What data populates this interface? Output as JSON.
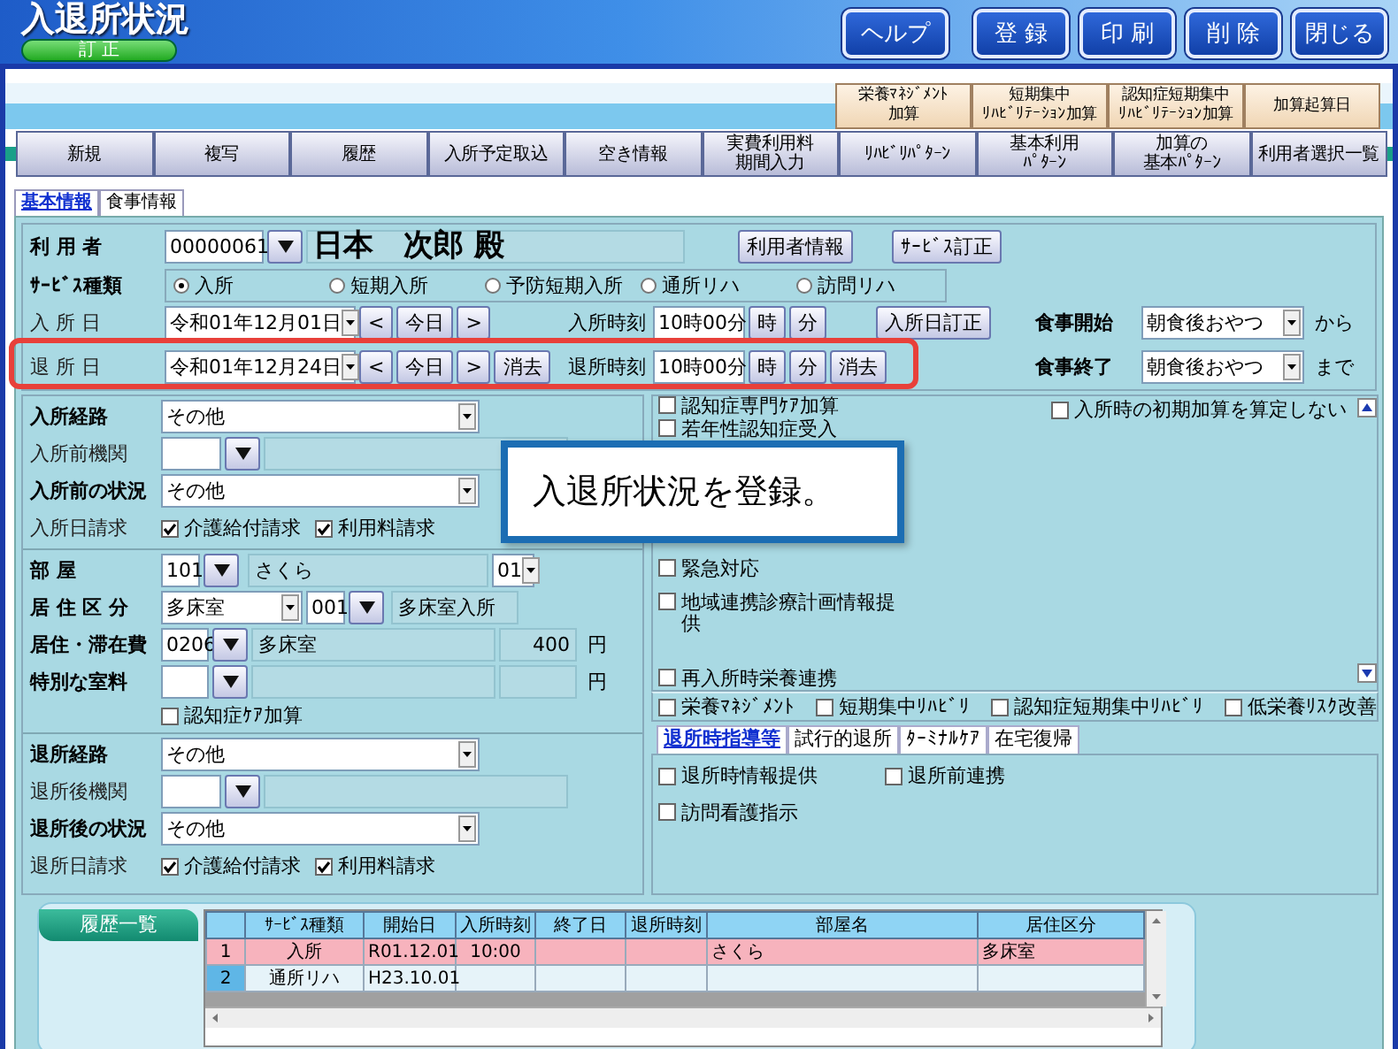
{
  "window": {
    "title": "入退所状況",
    "mode": "訂 正"
  },
  "header_buttons": [
    {
      "kind": "help",
      "label": "ヘルプ"
    },
    {
      "kind": "action",
      "label": "登 録"
    },
    {
      "kind": "action",
      "label": "印 刷"
    },
    {
      "kind": "action",
      "label": "削 除"
    },
    {
      "kind": "action",
      "label": "閉じる"
    }
  ],
  "addon_buttons": [
    {
      "lines": [
        "栄養ﾏﾈｼﾞﾒﾝﾄ",
        "加算"
      ]
    },
    {
      "lines": [
        "短期集中",
        "ﾘﾊﾋﾞﾘﾃｰｼｮﾝ加算"
      ]
    },
    {
      "lines": [
        "認知症短期集中",
        "ﾘﾊﾋﾞﾘﾃｰｼｮﾝ加算"
      ]
    },
    {
      "lines": [
        "加算起算日"
      ]
    }
  ],
  "nav_buttons": [
    {
      "lines": [
        "新規"
      ]
    },
    {
      "lines": [
        "複写"
      ]
    },
    {
      "lines": [
        "履歴"
      ]
    },
    {
      "lines": [
        "入所予定取込"
      ]
    },
    {
      "lines": [
        "空き情報"
      ]
    },
    {
      "lines": [
        "実費利用料",
        "期間入力"
      ]
    },
    {
      "lines": [
        "ﾘﾊﾋﾞﾘﾊﾟﾀｰﾝ"
      ]
    },
    {
      "lines": [
        "基本利用",
        "ﾊﾟﾀｰﾝ"
      ]
    },
    {
      "lines": [
        "加算の",
        "基本ﾊﾟﾀｰﾝ"
      ]
    },
    {
      "lines": [
        "利用者選択一覧"
      ]
    }
  ],
  "tabs": [
    {
      "label": "基本情報",
      "selected": true
    },
    {
      "label": "食事情報",
      "selected": false
    }
  ],
  "user": {
    "label": "利 用 者",
    "id": "00000061",
    "name": "日本　次郎 殿",
    "buttons": [
      "利用者情報",
      "ｻｰﾋﾞｽ訂正"
    ]
  },
  "service_type": {
    "label": "ｻｰﾋﾞｽ種類",
    "options": [
      {
        "label": "入所",
        "selected": true
      },
      {
        "label": "短期入所",
        "selected": false
      },
      {
        "label": "予防短期入所",
        "selected": false
      },
      {
        "label": "通所リハ",
        "selected": false
      },
      {
        "label": "訪問リハ",
        "selected": false
      }
    ]
  },
  "admission": {
    "label": "入 所 日",
    "date": "令和01年12月01日",
    "buttons": [
      "<",
      "今日",
      ">"
    ],
    "time_label": "入所時刻",
    "time": "10時00分",
    "time_buttons": [
      "時",
      "分"
    ],
    "correct_button": "入所日訂正"
  },
  "discharge": {
    "label": "退 所 日",
    "date": "令和01年12月24日",
    "buttons": [
      "<",
      "今日",
      ">",
      "消去"
    ],
    "time_label": "退所時刻",
    "time": "10時00分",
    "time_buttons": [
      "時",
      "分",
      "消去"
    ]
  },
  "meal": [
    {
      "label": "食事開始",
      "value": "朝食後おやつ",
      "suffix": "から"
    },
    {
      "label": "食事終了",
      "value": "朝食後おやつ",
      "suffix": "まで"
    }
  ],
  "admission_fields": [
    {
      "kind": "select",
      "label": "入所経路",
      "value": "その他"
    },
    {
      "kind": "lookup",
      "label": "入所前機関"
    },
    {
      "kind": "select",
      "label": "入所前の状況",
      "value": "その他"
    },
    {
      "kind": "checks",
      "label": "入所日請求",
      "checks": [
        {
          "label": "介護給付請求",
          "checked": true
        },
        {
          "label": "利用料請求",
          "checked": true
        }
      ]
    }
  ],
  "room_fields": [
    {
      "kind": "room",
      "label": "部 屋",
      "code": "101",
      "name": "さくら",
      "bed": "01"
    },
    {
      "kind": "residence",
      "label": "居 住 区 分",
      "value": "多床室",
      "code": "001",
      "name": "多床室入所"
    },
    {
      "kind": "fee",
      "label": "居住・滞在費",
      "code": "0206",
      "name": "多床室",
      "amount": "400",
      "unit": "円"
    },
    {
      "kind": "fee",
      "label": "特別な室料",
      "unit": "円"
    },
    {
      "kind": "check",
      "label": "認知症ｹｱ加算",
      "checked": false
    }
  ],
  "discharge_fields": [
    {
      "kind": "select",
      "label": "退所経路",
      "value": "その他"
    },
    {
      "kind": "lookup",
      "label": "退所後機関"
    },
    {
      "kind": "select",
      "label": "退所後の状況",
      "value": "その他"
    },
    {
      "kind": "checks",
      "label": "退所日請求",
      "checks": [
        {
          "label": "介護給付請求",
          "checked": true
        },
        {
          "label": "利用料請求",
          "checked": true
        }
      ]
    }
  ],
  "addition_checks": [
    {
      "label": "認知症専門ｹｱ加算",
      "checked": false
    },
    {
      "label": "若年性認知症受入",
      "checked": false
    },
    {
      "label": "緊急対応",
      "checked": false
    },
    {
      "label": "地域連携診療計画情報提供",
      "checked": false
    },
    {
      "label": "再入所時栄養連携",
      "checked": false
    }
  ],
  "initial_addition": {
    "label": "入所時の初期加算を算定しない",
    "checked": false
  },
  "bottom_checks": [
    {
      "label": "栄養ﾏﾈｼﾞﾒﾝﾄ",
      "checked": false
    },
    {
      "label": "短期集中ﾘﾊﾋﾞﾘ",
      "checked": false
    },
    {
      "label": "認知症短期集中ﾘﾊﾋﾞﾘ",
      "checked": false
    },
    {
      "label": "低栄養ﾘｽｸ改善",
      "checked": false
    }
  ],
  "sub_tabs": [
    {
      "label": "退所時指導等",
      "selected": true
    },
    {
      "label": "試行的退所",
      "selected": false
    },
    {
      "label": "ﾀｰﾐﾅﾙｹｱ",
      "selected": false
    },
    {
      "label": "在宅復帰",
      "selected": false
    }
  ],
  "sub_tab_checks": [
    {
      "label": "退所時情報提供",
      "checked": false
    },
    {
      "label": "退所前連携",
      "checked": false
    },
    {
      "label": "訪問看護指示",
      "checked": false
    }
  ],
  "history": {
    "title": "履歴一覧",
    "columns": [
      "ｻｰﾋﾞｽ種類",
      "開始日",
      "入所時刻",
      "終了日",
      "退所時刻",
      "部屋名",
      "居住区分"
    ],
    "rows": [
      {
        "no": "1",
        "selected": true,
        "cells": [
          "入所",
          "R01.12.01",
          "10:00",
          null,
          null,
          "さくら",
          "多床室"
        ]
      },
      {
        "no": "2",
        "selected": false,
        "cells": [
          "通所リハ",
          "H23.10.01",
          null,
          null,
          null,
          null,
          null
        ]
      }
    ]
  },
  "callout": "入退所状況を登録。"
}
